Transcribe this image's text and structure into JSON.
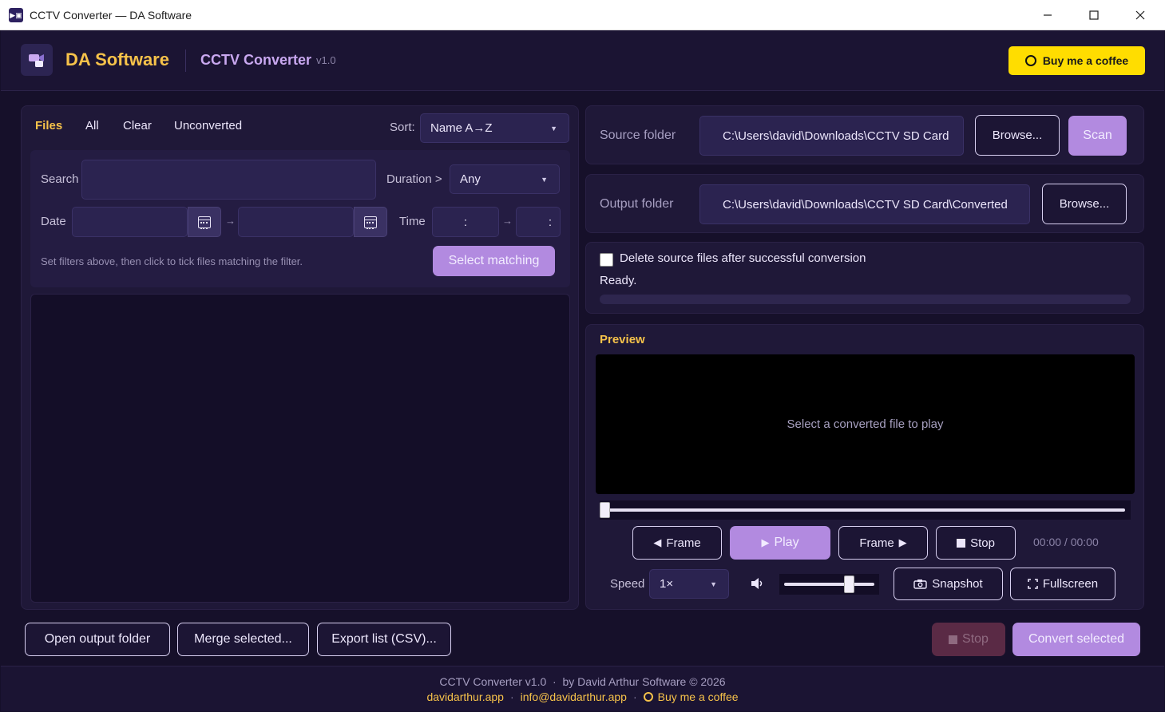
{
  "window": {
    "title": "CCTV Converter — DA Software",
    "icon": "app-icon"
  },
  "header": {
    "brand": "DA Software",
    "app_name": "CCTV Converter",
    "version": "v1.0",
    "coffee_button": "Buy me a coffee"
  },
  "files_panel": {
    "tabs": [
      "Files",
      "All",
      "Clear",
      "Unconverted"
    ],
    "sort_label": "Sort:",
    "sort_value": "Name A→Z",
    "filters": {
      "search_label": "Search",
      "search_value": "",
      "duration_label": "Duration >",
      "duration_value": "Any",
      "date_label": "Date",
      "date_from": "",
      "date_to": "",
      "arrow": "→",
      "time_label": "Time",
      "time_from": ":",
      "time_to": ":",
      "hint": "Set filters above, then click to tick files matching the filter.",
      "select_matching": "Select matching"
    },
    "files": []
  },
  "source": {
    "label": "Source folder",
    "path": "C:\\Users\\david\\Downloads\\CCTV SD Card",
    "browse": "Browse...",
    "scan": "Scan"
  },
  "output": {
    "label": "Output folder",
    "path": "C:\\Users\\david\\Downloads\\CCTV SD Card\\Converted",
    "browse": "Browse..."
  },
  "options": {
    "delete_label": "Delete source files after successful conversion",
    "delete_checked": false,
    "status": "Ready.",
    "progress": 0
  },
  "preview": {
    "title": "Preview",
    "placeholder": "Select a converted file to play",
    "seek": 0,
    "prev_frame": "Frame",
    "play": "Play",
    "next_frame": "Frame",
    "stop": "Stop",
    "time": "00:00 / 00:00",
    "speed_label": "Speed",
    "speed_value": "1×",
    "volume": 0.75,
    "snapshot": "Snapshot",
    "fullscreen": "Fullscreen"
  },
  "bottom": {
    "open_output": "Open output folder",
    "merge": "Merge selected...",
    "export": "Export list (CSV)...",
    "stop": "Stop",
    "convert": "Convert selected"
  },
  "footer": {
    "line1": "CCTV Converter v1.0  ·  by David Arthur Software © 2026",
    "site": "davidarthur.app",
    "email": "info@davidarthur.app",
    "sep": "·",
    "coffee": "Buy me a coffee"
  },
  "colors": {
    "accent": "#b28ae0",
    "brand": "#f6c24a",
    "coffee": "#ffdd00",
    "background": "#16102a"
  }
}
